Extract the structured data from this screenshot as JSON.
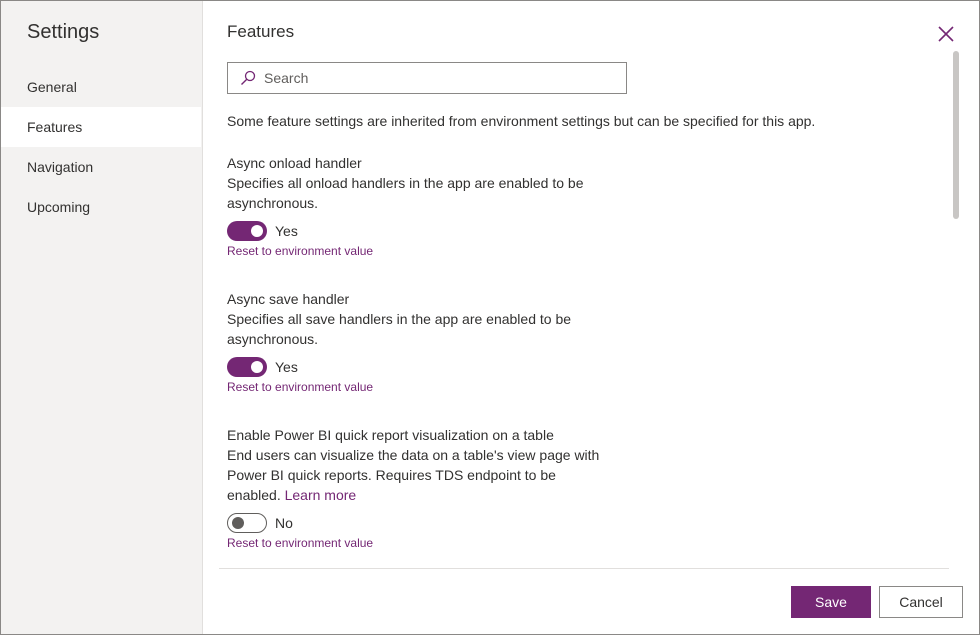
{
  "sidebar": {
    "title": "Settings",
    "items": [
      {
        "label": "General"
      },
      {
        "label": "Features"
      },
      {
        "label": "Navigation"
      },
      {
        "label": "Upcoming"
      }
    ]
  },
  "main": {
    "title": "Features",
    "search": {
      "placeholder": "Search",
      "value": ""
    },
    "intro": "Some feature settings are inherited from environment settings but can be specified for this app.",
    "features": [
      {
        "title": "Async onload handler",
        "desc": "Specifies all onload handlers in the app are enabled to be asynchronous.",
        "state": "Yes",
        "reset": "Reset to environment value"
      },
      {
        "title": "Async save handler",
        "desc": "Specifies all save handlers in the app are enabled to be asynchronous.",
        "state": "Yes",
        "reset": "Reset to environment value"
      },
      {
        "title": "Enable Power BI quick report visualization on a table",
        "desc": "End users can visualize the data on a table's view page with Power BI quick reports. Requires TDS endpoint to be enabled.",
        "link": "Learn more",
        "state": "No",
        "reset": "Reset to environment value"
      }
    ]
  },
  "footer": {
    "save_label": "Save",
    "cancel_label": "Cancel"
  },
  "colors": {
    "accent": "#742774",
    "sidebar_bg": "#f3f2f1"
  },
  "icons": {
    "close": "close-icon",
    "search": "search-icon"
  }
}
